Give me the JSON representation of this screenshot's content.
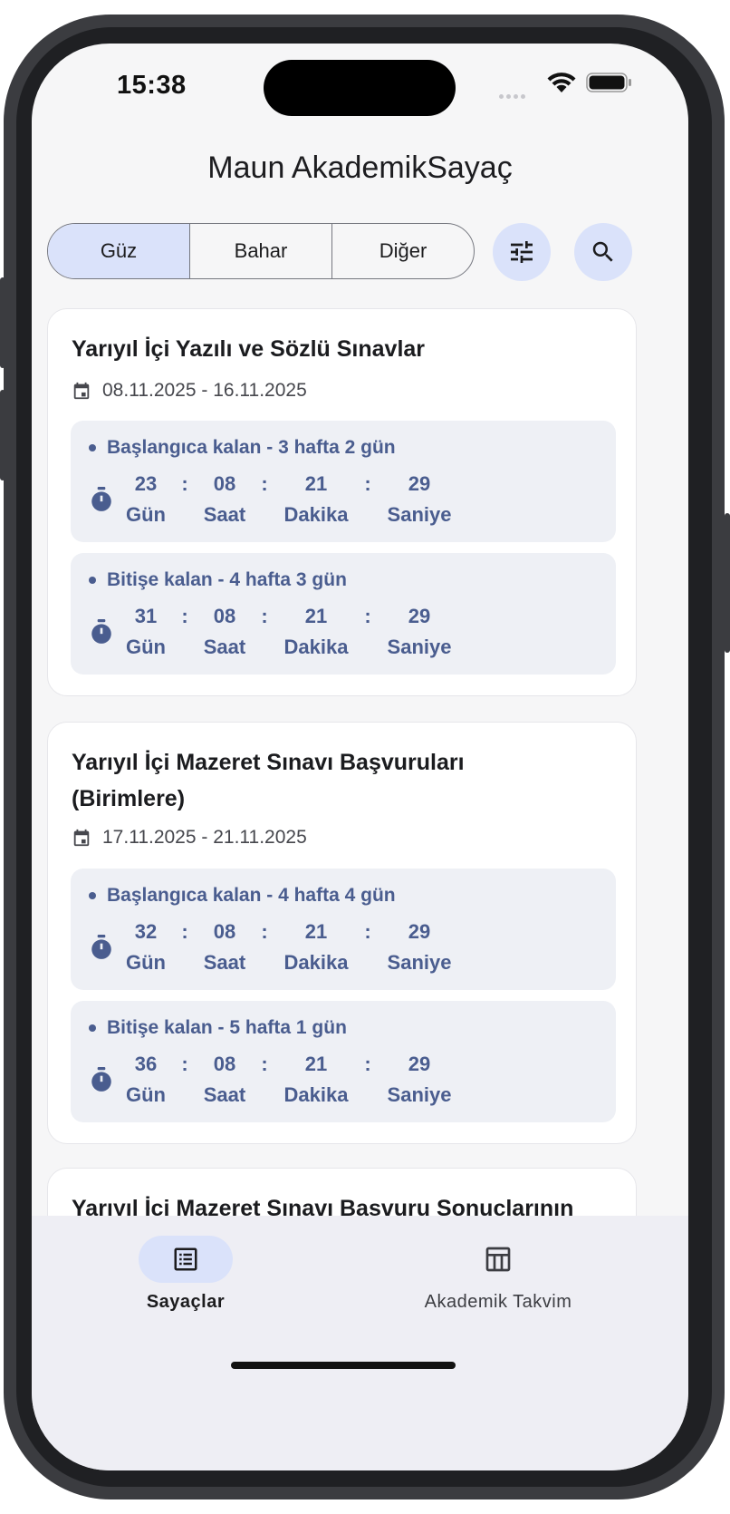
{
  "status_bar": {
    "time": "15:38"
  },
  "app": {
    "title": "Maun AkademikSayaç"
  },
  "tabs": [
    {
      "label": "Güz",
      "active": true
    },
    {
      "label": "Bahar",
      "active": false
    },
    {
      "label": "Diğer",
      "active": false
    }
  ],
  "actions": {
    "filter_icon": "tune-icon",
    "search_icon": "search-icon"
  },
  "cards": [
    {
      "title": "Yarıyıl İçi Yazılı ve Sözlü Sınavlar",
      "date": "08.11.2025 - 16.11.2025",
      "counters": [
        {
          "label": "Başlangıca kalan - 3 hafta 2 gün",
          "days": "23",
          "hours": "08",
          "minutes": "21",
          "seconds": "29"
        },
        {
          "label": "Bitişe kalan - 4 hafta 3 gün",
          "days": "31",
          "hours": "08",
          "minutes": "21",
          "seconds": "29"
        }
      ]
    },
    {
      "title": "Yarıyıl İçi Mazeret Sınavı Başvuruları (Birimlere)",
      "date": "17.11.2025 - 21.11.2025",
      "counters": [
        {
          "label": "Başlangıca kalan - 4 hafta 4 gün",
          "days": "32",
          "hours": "08",
          "minutes": "21",
          "seconds": "29"
        },
        {
          "label": "Bitişe kalan - 5 hafta 1 gün",
          "days": "36",
          "hours": "08",
          "minutes": "21",
          "seconds": "29"
        }
      ]
    },
    {
      "title": "Yarıyıl İçi Mazeret Sınavı Başvuru Sonuçlarının"
    }
  ],
  "units": {
    "days": "Gün",
    "hours": "Saat",
    "minutes": "Dakika",
    "seconds": "Saniye",
    "separator": ":"
  },
  "bottom_nav": [
    {
      "label": "Sayaçlar",
      "icon": "list-icon",
      "active": true
    },
    {
      "label": "Akademik Takvim",
      "icon": "table-icon",
      "active": false
    }
  ],
  "colors": {
    "accent": "#dae2fa",
    "counter_text": "#4a5d8f",
    "counter_bg": "#eef0f5"
  }
}
